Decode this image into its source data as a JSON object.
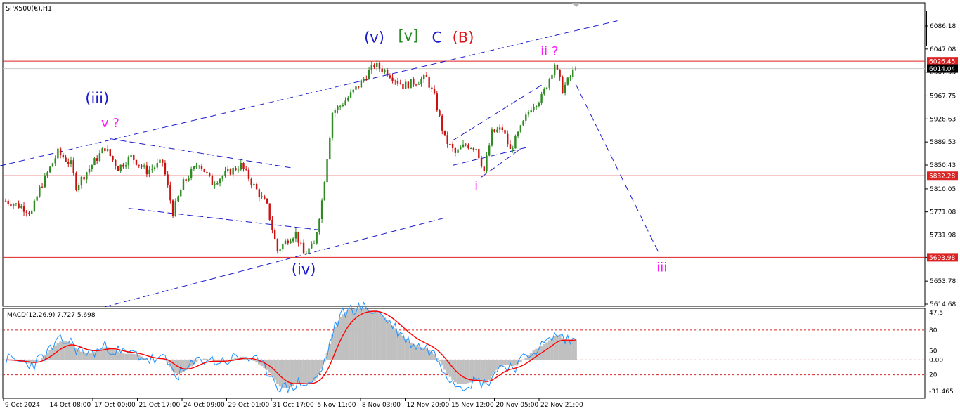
{
  "title": "SPX500(€),H1",
  "colors": {
    "up": "#2e8b22",
    "down": "#cc1111",
    "hline": "#dd2222",
    "channel": "#1a1acc",
    "blue_label": "#1a1acc",
    "magenta_label": "#ff19ff",
    "green_label": "#228b22",
    "red_label": "#dd1111",
    "macd_line": "#1e90ff",
    "macd_signal": "#ff0000",
    "macd_hist": "#c0c0c0"
  },
  "price_axis": {
    "ticks": [
      "6086.18",
      "6047.08",
      "6007.93",
      "5967.75",
      "5928.63",
      "5889.53",
      "5850.43",
      "5810.05",
      "5771.08",
      "5731.98",
      "5693.98",
      "5653.78",
      "5614.68"
    ],
    "min": 5614.68,
    "max": 6086.18
  },
  "price_tags": [
    {
      "label": "6026.45",
      "value": 6026.45,
      "style": "red"
    },
    {
      "label": "6014.04",
      "value": 6014.04,
      "style": "dark"
    },
    {
      "label": "5832.28",
      "value": 5832.28,
      "style": "red"
    },
    {
      "label": "5693.98",
      "value": 5693.98,
      "style": "red"
    }
  ],
  "time_axis": [
    "9 Oct 2024",
    "14 Oct 08:00",
    "17 Oct 00:00",
    "21 Oct 17:00",
    "24 Oct 09:00",
    "29 Oct 01:00",
    "31 Oct 17:00",
    "5 Nov 11:00",
    "8 Nov 03:00",
    "12 Nov 20:00",
    "15 Nov 12:00",
    "20 Nov 05:00",
    "22 Nov 21:00"
  ],
  "wave_labels": [
    {
      "text": "(iii)",
      "color": "blue",
      "bar": 35,
      "price": 5955,
      "size": 21
    },
    {
      "text": "v ?",
      "color": "magenta",
      "bar": 40,
      "price": 5915,
      "size": 18
    },
    {
      "text": "(iv)",
      "color": "blue",
      "bar": 114,
      "price": 5665,
      "size": 21
    },
    {
      "text": "(v)",
      "color": "blue",
      "bar": 141,
      "price": 6058,
      "size": 21
    },
    {
      "text": "[v]",
      "color": "green",
      "bar": 154,
      "price": 6061,
      "size": 21
    },
    {
      "text": "C",
      "color": "blue",
      "bar": 165,
      "price": 6058,
      "size": 21
    },
    {
      "text": "(B)",
      "color": "red",
      "bar": 175,
      "price": 6058,
      "size": 21
    },
    {
      "text": "ii ?",
      "color": "magenta",
      "bar": 208,
      "price": 6036,
      "size": 18
    },
    {
      "text": "i",
      "color": "magenta",
      "bar": 180,
      "price": 5808,
      "size": 18
    },
    {
      "text": "iii",
      "color": "magenta",
      "bar": 251,
      "price": 5670,
      "size": 18
    }
  ],
  "macd": {
    "label": "MACD(12,26,9) 7.727 5.698",
    "ticks": [
      "47.5",
      "80",
      "50",
      "0.00",
      "20",
      "-31.465"
    ],
    "levels": {
      "top": 47.5,
      "upper": 30,
      "zero": 0,
      "lower": -15,
      "bottom": -31.465
    },
    "signal_value": 5.698,
    "macd_value": 7.727
  },
  "chart_data": {
    "type": "candlestick",
    "title": "SPX500(€),H1",
    "ylim": [
      5614.68,
      6086.18
    ],
    "horizontal_levels": [
      6026.45,
      6014.04,
      5832.28,
      5693.98
    ],
    "anchors": [
      {
        "bar": 0,
        "price": 5790
      },
      {
        "bar": 6,
        "price": 5780
      },
      {
        "bar": 10,
        "price": 5770
      },
      {
        "bar": 13,
        "price": 5810
      },
      {
        "bar": 20,
        "price": 5872
      },
      {
        "bar": 25,
        "price": 5852
      },
      {
        "bar": 27,
        "price": 5815
      },
      {
        "bar": 32,
        "price": 5845
      },
      {
        "bar": 38,
        "price": 5880
      },
      {
        "bar": 43,
        "price": 5845
      },
      {
        "bar": 48,
        "price": 5865
      },
      {
        "bar": 54,
        "price": 5840
      },
      {
        "bar": 60,
        "price": 5855
      },
      {
        "bar": 64,
        "price": 5770
      },
      {
        "bar": 68,
        "price": 5820
      },
      {
        "bar": 74,
        "price": 5855
      },
      {
        "bar": 79,
        "price": 5820
      },
      {
        "bar": 84,
        "price": 5835
      },
      {
        "bar": 90,
        "price": 5850
      },
      {
        "bar": 95,
        "price": 5815
      },
      {
        "bar": 100,
        "price": 5780
      },
      {
        "bar": 104,
        "price": 5705
      },
      {
        "bar": 108,
        "price": 5725
      },
      {
        "bar": 111,
        "price": 5735
      },
      {
        "bar": 114,
        "price": 5700
      },
      {
        "bar": 118,
        "price": 5715
      },
      {
        "bar": 121,
        "price": 5790
      },
      {
        "bar": 125,
        "price": 5940
      },
      {
        "bar": 129,
        "price": 5955
      },
      {
        "bar": 135,
        "price": 5985
      },
      {
        "bar": 141,
        "price": 6020
      },
      {
        "bar": 146,
        "price": 6008
      },
      {
        "bar": 152,
        "price": 5985
      },
      {
        "bar": 157,
        "price": 5992
      },
      {
        "bar": 161,
        "price": 5998
      },
      {
        "bar": 164,
        "price": 5965
      },
      {
        "bar": 168,
        "price": 5895
      },
      {
        "bar": 172,
        "price": 5870
      },
      {
        "bar": 176,
        "price": 5885
      },
      {
        "bar": 180,
        "price": 5880
      },
      {
        "bar": 183,
        "price": 5840
      },
      {
        "bar": 186,
        "price": 5905
      },
      {
        "bar": 190,
        "price": 5912
      },
      {
        "bar": 193,
        "price": 5875
      },
      {
        "bar": 197,
        "price": 5912
      },
      {
        "bar": 201,
        "price": 5950
      },
      {
        "bar": 205,
        "price": 5965
      },
      {
        "bar": 208,
        "price": 5998
      },
      {
        "bar": 210,
        "price": 6022
      },
      {
        "bar": 213,
        "price": 5978
      },
      {
        "bar": 216,
        "price": 6000
      },
      {
        "bar": 218,
        "price": 6018
      }
    ],
    "projection": [
      {
        "bar": 218,
        "price": 5988
      },
      {
        "bar": 250,
        "price": 5700
      }
    ],
    "channels": [
      {
        "from": {
          "bar": -6,
          "price": 5845
        },
        "to": {
          "bar": 234,
          "price": 6095
        }
      },
      {
        "from": {
          "bar": 38,
          "price": 5610
        },
        "to": {
          "bar": 168,
          "price": 5761
        }
      },
      {
        "from": {
          "bar": 40,
          "price": 5895
        },
        "to": {
          "bar": 109,
          "price": 5846
        }
      },
      {
        "from": {
          "bar": 47,
          "price": 5777
        },
        "to": {
          "bar": 121,
          "price": 5740
        }
      },
      {
        "from": {
          "bar": 171,
          "price": 5892
        },
        "to": {
          "bar": 205,
          "price": 5986
        }
      },
      {
        "from": {
          "bar": 171,
          "price": 5850
        },
        "to": {
          "bar": 199,
          "price": 5880
        }
      },
      {
        "from": {
          "bar": 182,
          "price": 5830
        },
        "to": {
          "bar": 197,
          "price": 5878
        }
      }
    ]
  }
}
